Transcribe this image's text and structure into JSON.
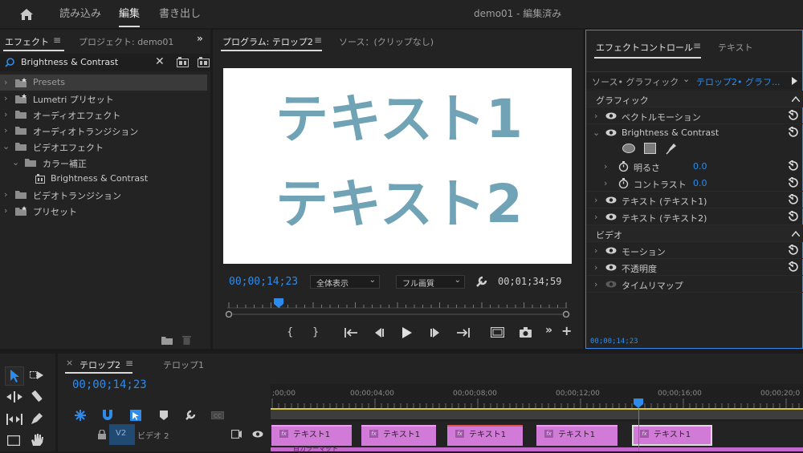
{
  "topbar": {
    "menu": [
      "読み込み",
      "編集",
      "書き出し"
    ],
    "active": "編集",
    "title": "demo01",
    "status": " - 編集済み"
  },
  "effects_panel": {
    "tab_effects": "エフェクト",
    "tab_project": "プロジェクト: demo01",
    "search_value": "Brightness & Contrast",
    "items": [
      {
        "label": "Presets"
      },
      {
        "label": "Lumetri プリセット"
      },
      {
        "label": "オーディオエフェクト"
      },
      {
        "label": "オーディオトランジション"
      },
      {
        "label": "ビデオエフェクト"
      },
      {
        "label": "カラー補正"
      },
      {
        "label": "Brightness & Contrast"
      },
      {
        "label": "ビデオトランジション"
      },
      {
        "label": "プリセット"
      }
    ]
  },
  "program_monitor": {
    "tab_program": "プログラム: テロップ2",
    "tab_source": "ソース：(クリップなし)",
    "frame_text_1": "テキスト1",
    "frame_text_2": "テキスト2",
    "current_time": "00;00;14;23",
    "zoom_select": "全体表示",
    "quality_select": "フル画質",
    "duration": "00;01;34;59",
    "playhead_fraction": 0.148
  },
  "effect_controls": {
    "tab_effect_controls": "エフェクトコントロール",
    "tab_text": "テキスト",
    "source_label": "ソース• グラフィック",
    "sequence_label": "テロップ2• グラフ...",
    "section_graphic": "グラフィック",
    "vector_motion": "ベクトルモーション",
    "brightness_contrast": "Brightness & Contrast",
    "brightness_label": "明るさ",
    "brightness_value": "0.0",
    "contrast_label": "コントラスト",
    "contrast_value": "0.0",
    "text1": "テキスト (テキスト1)",
    "text2": "テキスト (テキスト2)",
    "section_video": "ビデオ",
    "motion": "モーション",
    "opacity": "不透明度",
    "time_remap": "タイムリマップ",
    "timecode": "00;00;14;23"
  },
  "timeline": {
    "tab_active": "テロップ2",
    "tab_other": "テロップ1",
    "current_time": "00;00;14;23",
    "ruler": [
      ";00;00",
      "00;00;04;00",
      "00;00;08;00",
      "00;00;12;00",
      "00;00;16;00",
      "00;00;20;0"
    ],
    "track_v2": "V2",
    "track_name": "ビデオ 2",
    "clips": [
      "テキスト1",
      "テキスト1",
      "テキスト1",
      "テキスト1",
      "テキスト1"
    ],
    "fx_badge": "fx",
    "bottom_clip": "白カラーマット",
    "colors": {
      "accent": "#2d8ceb",
      "clip": "#d27ad8",
      "frame_text": "#6fa3b5"
    }
  }
}
